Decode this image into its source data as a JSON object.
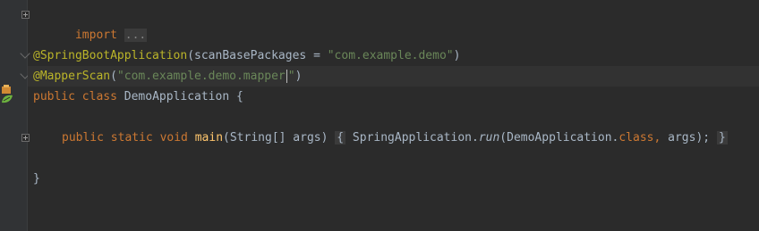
{
  "editor": {
    "lines": {
      "import": {
        "keyword": "import",
        "folded": "..."
      },
      "boot_annotation": {
        "annotation": "@SpringBootApplication",
        "open": "(",
        "param": "scanBasePackages",
        "equals": " = ",
        "value": "\"com.example.demo\"",
        "close": ")"
      },
      "mapper_annotation": {
        "annotation": "@MapperScan",
        "open": "(",
        "value_before_caret": "\"com.example.demo.mapper",
        "value_after_caret": "\"",
        "close": ")"
      },
      "class_decl": {
        "modifier": "public",
        "keyword": "class",
        "name": "DemoApplication",
        "brace": "{"
      },
      "main_method": {
        "modifiers": "public static void",
        "name": "main",
        "params": "(String[] args)",
        "body_open": "{",
        "call_target": "SpringApplication.",
        "call_method": "run",
        "call_args_start": "(DemoApplication.",
        "call_kw": "class,",
        "call_args_end": " args);",
        "body_close": "}"
      },
      "class_close": {
        "brace": "}"
      }
    }
  },
  "icons": {
    "fold": "fold-marker-icon",
    "run": "run-spring-boot-icon"
  },
  "colors": {
    "background": "#2b2b2b",
    "gutter": "#313335",
    "text": "#a9b7c6",
    "keyword": "#cc7832",
    "annotation": "#bbb529",
    "string": "#6a8759",
    "method": "#ffc66d"
  }
}
